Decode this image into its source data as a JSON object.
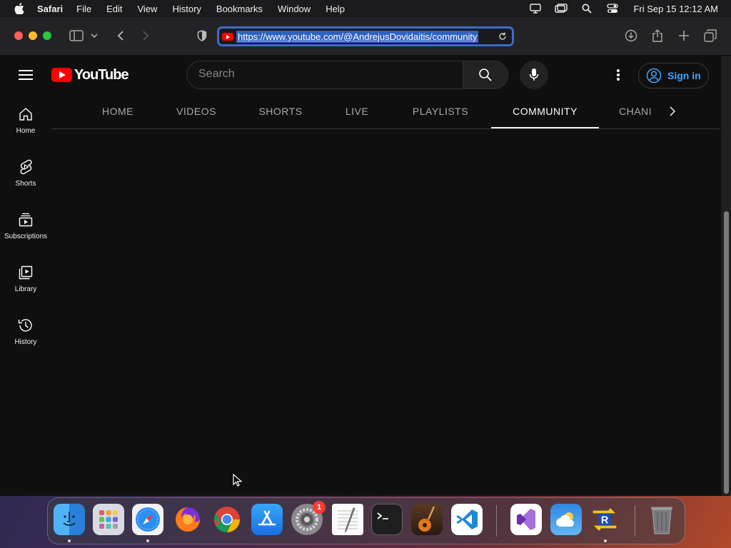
{
  "menubar": {
    "app_name": "Safari",
    "items": [
      "File",
      "Edit",
      "View",
      "History",
      "Bookmarks",
      "Window",
      "Help"
    ],
    "clock": "Fri Sep 15  12:12 AM"
  },
  "browser": {
    "url": "https://www.youtube.com/@AndrejusDovidaitis/community"
  },
  "youtube": {
    "logo_text": "YouTube",
    "search_placeholder": "Search",
    "sign_in": "Sign in",
    "sidebar": [
      {
        "label": "Home",
        "icon": "home-icon"
      },
      {
        "label": "Shorts",
        "icon": "shorts-icon"
      },
      {
        "label": "Subscriptions",
        "icon": "subscriptions-icon"
      },
      {
        "label": "Library",
        "icon": "library-icon"
      },
      {
        "label": "History",
        "icon": "history-icon"
      }
    ],
    "tabs": [
      "HOME",
      "VIDEOS",
      "SHORTS",
      "LIVE",
      "PLAYLISTS",
      "COMMUNITY",
      "CHANI"
    ],
    "active_tab": "COMMUNITY"
  },
  "dock": {
    "apps": [
      "finder",
      "launchpad",
      "safari",
      "firefox",
      "chrome",
      "app-store",
      "system-settings",
      "textedit",
      "terminal",
      "garageband",
      "vscode",
      "visual-studio",
      "weather",
      "rstudio",
      "trash"
    ],
    "settings_badge": "1"
  },
  "colors": {
    "accent_link": "#3ea6ff",
    "youtube_red": "#ff0000",
    "address_focus": "#3a6ec8"
  }
}
